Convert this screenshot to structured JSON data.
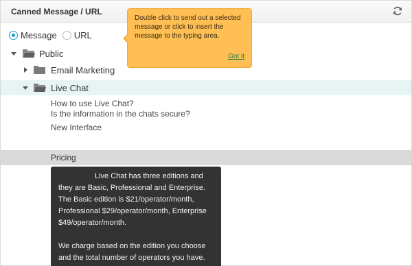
{
  "header": {
    "title": "Canned Message / URL",
    "refresh_icon": "refresh-icon"
  },
  "mode": {
    "options": [
      {
        "label": "Message",
        "selected": true
      },
      {
        "label": "URL",
        "selected": false
      }
    ]
  },
  "tree": {
    "root": {
      "label": "Public",
      "expanded": true
    },
    "folders": [
      {
        "label": "Email Marketing",
        "expanded": false
      },
      {
        "label": "Live Chat",
        "expanded": true
      }
    ],
    "messages": [
      "How to use Live Chat?",
      "Is the information in the chats secure?",
      "New Interface",
      "Pricing"
    ]
  },
  "hint_tooltip": {
    "text": "Double click to send out a selected message or click to insert the message to the typing area.",
    "action": "Got it"
  },
  "preview_tooltip": {
    "paragraph1": "Live Chat has three editions and they are Basic, Professional and Enterprise. The Basic edition is $21/operator/month, Professional $29/operator/month, Enterprise $49/operator/month.",
    "paragraph2": "We charge based on the edition you choose and the total number of operators you have. Operators are the people who are able to log"
  },
  "colors": {
    "accent": "#1a9bd1",
    "hint_bg": "#ffbf55",
    "selected_row": "#e7f4f4",
    "hover_row": "#dadada",
    "preview_bg": "#333333",
    "got_it_link": "#1b7f3a"
  }
}
